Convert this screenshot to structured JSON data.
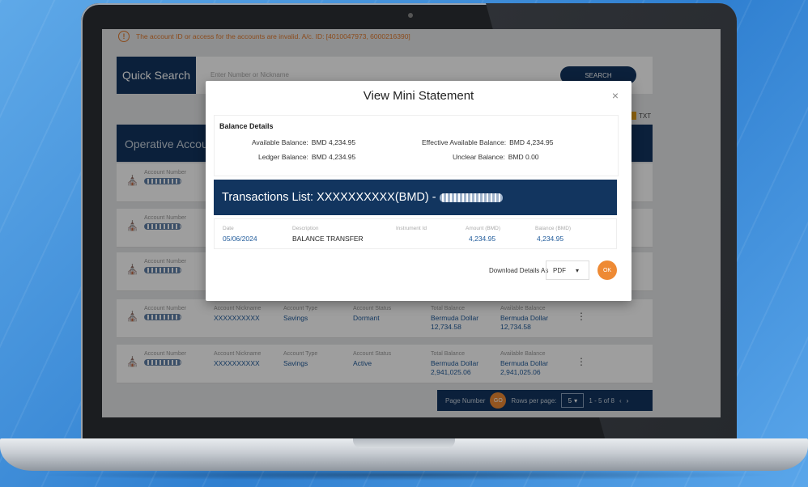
{
  "alert": {
    "icon": "warning-circle-icon",
    "text": "The account ID or access for the accounts are invalid. A/c. ID: [4010047973, 6000216390]"
  },
  "quick_search": {
    "title": "Quick Search",
    "placeholder": "Enter Number or Nickname",
    "button": "SEARCH"
  },
  "download_tag": "TXT",
  "operative": {
    "title": "Operative Accounts"
  },
  "accounts": [
    {
      "label_num": "Account Number",
      "label_nick": "Account Nickname",
      "nick": "XXXXXXXXXX",
      "label_type": "Account Type",
      "type": "Savings",
      "label_status": "Account Status",
      "status": "Dormant",
      "label_total": "Total Balance",
      "total_cur": "Bermuda Dollar",
      "total": "12,734.58",
      "label_avail": "Available Balance",
      "avail_cur": "Bermuda Dollar",
      "avail": "12,734.58"
    },
    {
      "label_num": "Account Number",
      "label_nick": "Account Nickname",
      "nick": "XXXXXXXXXX",
      "label_type": "Account Type",
      "type": "Savings",
      "label_status": "Account Status",
      "status": "Active",
      "label_total": "Total Balance",
      "total_cur": "Bermuda Dollar",
      "total": "2,941,025.06",
      "label_avail": "Available Balance",
      "avail_cur": "Bermuda Dollar",
      "avail": "2,941,025.06"
    }
  ],
  "hidden_rows": [
    {
      "label_num": "Account Number"
    },
    {
      "label_num": "Account Number"
    },
    {
      "label_num": "Account Number"
    }
  ],
  "pager": {
    "page_number": "Page Number",
    "go": "GO",
    "rows_label": "Rows per page:",
    "rows": "5",
    "range": "1 - 5 of 8"
  },
  "modal": {
    "title": "View Mini Statement",
    "close": "×",
    "balance_header": "Balance Details",
    "available_label": "Available Balance:",
    "available": "BMD 4,234.95",
    "effective_label": "Effective Available Balance:",
    "effective": "BMD 4,234.95",
    "ledger_label": "Ledger Balance:",
    "ledger": "BMD 4,234.95",
    "unclear_label": "Unclear Balance:",
    "unclear": "BMD 0.00",
    "tx_title": "Transactions List: XXXXXXXXXX(BMD) -",
    "columns": {
      "date": "Date",
      "desc": "Description",
      "inst": "Instrument Id",
      "amount": "Amount (BMD)",
      "balance": "Balance (BMD)"
    },
    "row": {
      "date": "05/06/2024",
      "desc": "BALANCE TRANSFER",
      "amount": "4,234.95",
      "balance": "4,234.95"
    },
    "download_label": "Download Details As",
    "format": "PDF",
    "ok": "OK"
  },
  "colors": {
    "navy": "#12355f",
    "orange": "#ee8a34",
    "link_blue": "#1f5a9a"
  }
}
